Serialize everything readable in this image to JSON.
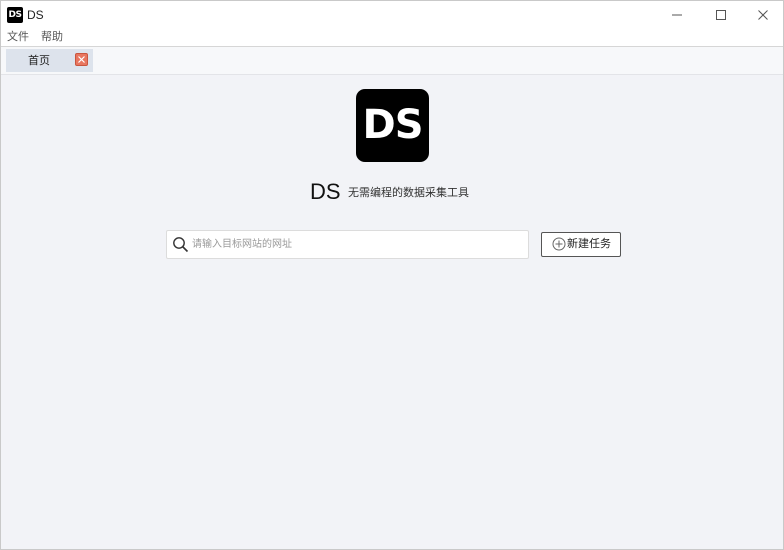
{
  "window": {
    "app_icon_text": "DS",
    "title": "DS",
    "minimize_icon": "minimize-icon",
    "maximize_icon": "maximize-icon",
    "close_icon": "close-icon"
  },
  "menu": {
    "file_label": "文件",
    "help_label": "帮助"
  },
  "tabs": [
    {
      "label": "首页",
      "close_icon": "close-icon",
      "active": true
    }
  ],
  "main": {
    "logo_text": "DS",
    "brand_name": "DS",
    "tagline": "无需编程的数据采集工具",
    "search": {
      "icon": "search-icon",
      "value": "",
      "placeholder": "请输入目标网站的网址"
    },
    "new_task_button": {
      "icon": "plus-circle-icon",
      "label": "新建任务"
    }
  },
  "colors": {
    "background": "#f2f3f7",
    "tab_active": "#dde3ec",
    "tab_close": "#e8765f",
    "logo": "#000000"
  }
}
